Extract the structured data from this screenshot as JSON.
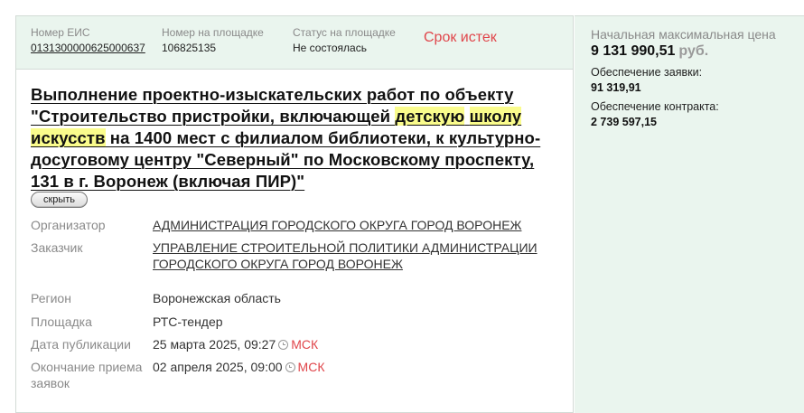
{
  "header": {
    "eis_label": "Номер ЕИС",
    "eis_value": "0131300000625000637",
    "platform_number_label": "Номер на площадке",
    "platform_number_value": "106825135",
    "platform_status_label": "Статус на площадке",
    "platform_status_value": "Не состоялась",
    "expired_label": "Срок истек"
  },
  "title": {
    "part1": "Выполнение проектно-изыскательских работ по объекту \"Строительство пристройки, включающей ",
    "hl1": "детскую",
    "sp1": " ",
    "hl2": "школу",
    "sp2": " ",
    "hl3": "искусств",
    "part2": " на 1400 мест с филиалом библиотеки, к культурно-досуговому центру \"Северный\" по Московскому проспекту, 131 в г. Воронеж (включая ПИР)\""
  },
  "hide_button_label": "скрыть",
  "details": {
    "organizer_label": "Организатор",
    "organizer_value": "АДМИНИСТРАЦИЯ ГОРОДСКОГО ОКРУГА ГОРОД ВОРОНЕЖ",
    "customer_label": "Заказчик",
    "customer_value_line1": "УПРАВЛЕНИЕ СТРОИТЕЛЬНОЙ ПОЛИТИКИ АДМИНИСТРАЦИИ",
    "customer_value_line2": "ГОРОДСКОГО ОКРУГА ГОРОД ВОРОНЕЖ",
    "region_label": "Регион",
    "region_value": "Воронежская область",
    "platform_label": "Площадка",
    "platform_value": "РТС-тендер",
    "published_label": "Дата публикации",
    "published_value": "25 марта 2025, 09:27",
    "published_tz": "МСК",
    "deadline_label_line1": "Окончание приема",
    "deadline_label_line2": "заявок",
    "deadline_value": "02 апреля 2025, 09:00",
    "deadline_tz": "МСК"
  },
  "side": {
    "initial_price_label": "Начальная максимальная цена",
    "initial_price_value": "9 131 990,51",
    "currency": "руб.",
    "bid_security_label": "Обеспечение заявки:",
    "bid_security_value": "91 319,91",
    "contract_security_label": "Обеспечение контракта:",
    "contract_security_value": "2 739 597,15"
  },
  "colors": {
    "accent_green_bg": "#eaf5ee",
    "expired_red": "#e0464b",
    "highlight_yellow": "#fafc8c"
  },
  "icons": {
    "published_clock": "clock-icon",
    "deadline_clock": "clock-icon"
  }
}
